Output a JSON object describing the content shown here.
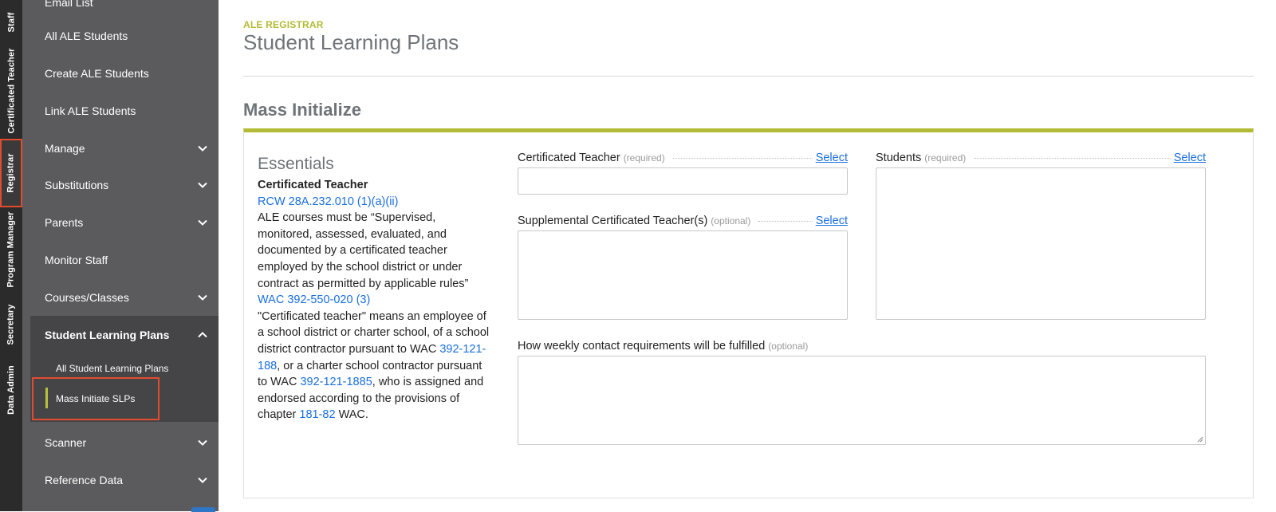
{
  "rail": {
    "tabs": [
      {
        "label": "Staff",
        "active": false
      },
      {
        "label": "Certificated Teacher",
        "active": false
      },
      {
        "label": "Registrar",
        "active": true
      },
      {
        "label": "Program Manager",
        "active": false
      },
      {
        "label": "Secretary",
        "active": false
      },
      {
        "label": "Data Admin",
        "active": false
      }
    ]
  },
  "sidebar": {
    "items": [
      {
        "label": "Email List",
        "has_children": false
      },
      {
        "label": "All ALE Students",
        "has_children": false
      },
      {
        "label": "Create ALE Students",
        "has_children": false
      },
      {
        "label": "Link ALE Students",
        "has_children": false
      },
      {
        "label": "Manage",
        "has_children": true
      },
      {
        "label": "Substitutions",
        "has_children": true
      },
      {
        "label": "Parents",
        "has_children": true
      },
      {
        "label": "Monitor Staff",
        "has_children": false
      },
      {
        "label": "Courses/Classes",
        "has_children": true
      },
      {
        "label": "Student Learning Plans",
        "has_children": true,
        "expanded": true
      },
      {
        "label": "Scanner",
        "has_children": true
      },
      {
        "label": "Reference Data",
        "has_children": true
      }
    ],
    "sub_items": [
      {
        "label": "All Student Learning Plans",
        "active": false
      },
      {
        "label": "Mass Initiate SLPs",
        "active": true
      }
    ]
  },
  "header": {
    "eyebrow": "ALE REGISTRAR",
    "title": "Student Learning Plans"
  },
  "section": {
    "title": "Mass Initialize"
  },
  "essentials": {
    "title": "Essentials",
    "subtitle": "Certificated Teacher",
    "rcw_link": "RCW 28A.232.010 (1)(a)(ii)",
    "rcw_text": "ALE courses must be “Supervised, monitored, assessed, evaluated, and documented by a certificated teacher employed by the school district or under contract as permitted by applicable rules”",
    "wac_link": "WAC 392-550-020 (3)",
    "wac_text_1": "\"Certificated teacher\" means an employee of a school district or charter school, of a school district contractor pursuant to WAC ",
    "wac_ref_1": "392-121-188",
    "wac_text_2": ", or a charter school contractor pursuant to WAC ",
    "wac_ref_2": "392-121-1885",
    "wac_text_3": ", who is assigned and endorsed according to the provisions of chapter ",
    "wac_ref_3": "181-82",
    "wac_text_4": " WAC."
  },
  "form": {
    "teacher": {
      "label": "Certificated Teacher",
      "hint": "(required)",
      "action": "Select",
      "value": ""
    },
    "supplemental": {
      "label": "Supplemental Certificated Teacher(s)",
      "hint": "(optional)",
      "action": "Select",
      "value": ""
    },
    "students": {
      "label": "Students",
      "hint": "(required)",
      "action": "Select",
      "value": ""
    },
    "weekly": {
      "label": "How weekly contact requirements will be fulfilled",
      "hint": "(optional)",
      "value": ""
    }
  },
  "colors": {
    "accent": "#b3bb35",
    "link": "#1a6fe0",
    "highlight": "#e24b2e",
    "sidebar": "#5b5b5d",
    "rail": "#2b2b2b"
  }
}
